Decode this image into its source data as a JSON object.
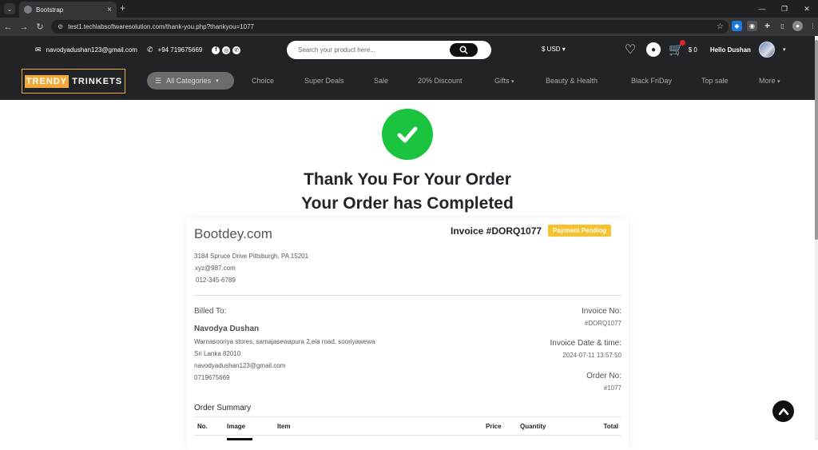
{
  "browser": {
    "tab_title": "Bootstrap",
    "url": "test1.techlabsoftwaresolution.com/thank-you.php?thankyou=1077"
  },
  "header": {
    "email": "navodyadushan123@gmail.com",
    "phone": "+94 719675669",
    "search_placeholder": "Search your product here...",
    "currency": "$ USD",
    "cart_total": "$ 0",
    "greeting": "Hello Dushan",
    "logo_part1": "TRENDY",
    "logo_part2": "TRINKETS",
    "categories_label": "All Categories",
    "nav": [
      "Choice",
      "Super Deals",
      "Sale",
      "20% Discount",
      "Gifts",
      "Beauty & Health",
      "Black FriDay",
      "Top sale",
      "More"
    ]
  },
  "hero": {
    "line1": "Thank You For Your Order",
    "line2": "Your Order has Completed"
  },
  "invoice": {
    "company": "Bootdey.com",
    "title": "Invoice #DORQ1077",
    "status": "Payment Pending",
    "company_address": "3184 Spruce Drive Pittsburgh, PA 15201",
    "company_email": "xyz@987.com",
    "company_phone": "012-345-6789",
    "billed_to_label": "Billed To:",
    "customer_name": "Navodya Dushan",
    "customer_address1": "Warnasooriya stores, samajasewapura 2,ela road, sooriyawewa",
    "customer_address2": "Sri Lanka 82010",
    "customer_email": "navodyadushan123@gmail.com",
    "customer_phone": "0719675669",
    "invoice_no_label": "Invoice No:",
    "invoice_no": "#DORQ1077",
    "date_label": "Invoice Date & time:",
    "date": "2024-07-11 13:57:50",
    "order_no_label": "Order No:",
    "order_no": "#1077",
    "summary_label": "Order Summary",
    "columns": [
      "No.",
      "Image",
      "Item",
      "Price",
      "Quantity",
      "Total"
    ]
  },
  "colors": {
    "header_bg": "#212326",
    "accent": "#f0a93a",
    "success": "#1bc43e",
    "badge": "#f5c12e"
  }
}
